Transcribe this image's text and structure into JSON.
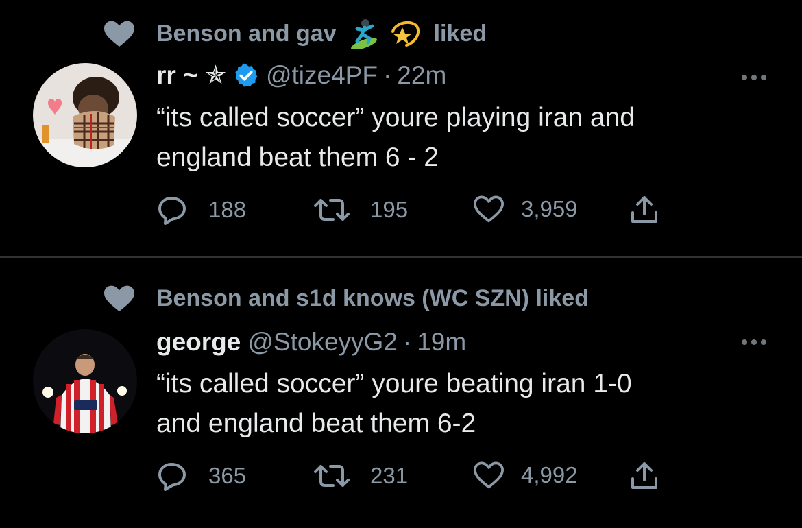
{
  "tweets": [
    {
      "social_context": {
        "name": "Benson and gav",
        "emojis": [
          "surfer-emoji",
          "dizzy-star-emoji"
        ],
        "suffix": "liked"
      },
      "author": {
        "name": "rr ~ ✯",
        "verified": true,
        "handle": "@tize4PF",
        "time": "22m"
      },
      "text_line1": "“its called soccer” youre playing iran and",
      "text_line2": "england beat them 6 - 2",
      "stats": {
        "replies": "188",
        "retweets": "195",
        "likes": "3,959"
      }
    },
    {
      "social_context": {
        "text": "Benson and s1d knows (WC SZN) liked"
      },
      "author": {
        "name": "george",
        "verified": false,
        "handle": "@StokeyyG2",
        "time": "19m"
      },
      "text_line1": "“its called soccer” youre beating iran 1-0",
      "text_line2": "and england beat them 6-2",
      "stats": {
        "replies": "365",
        "retweets": "231",
        "likes": "4,992"
      }
    }
  ],
  "colors": {
    "background": "#000000",
    "text": "#e7e9ea",
    "muted": "#8b98a5",
    "verified": "#1d9bf0",
    "divider": "#2f3336"
  },
  "icons": [
    "heart-icon",
    "verified-icon",
    "more-icon",
    "reply-icon",
    "retweet-icon",
    "like-icon",
    "share-icon"
  ]
}
